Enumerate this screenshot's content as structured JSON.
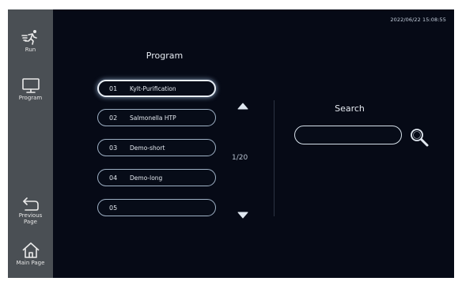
{
  "header": {
    "timestamp": "2022/06/22 15:08:55"
  },
  "sidebar": {
    "items": [
      {
        "label": "Run",
        "icon": "running-person-icon"
      },
      {
        "label": "Program",
        "icon": "monitor-icon"
      },
      {
        "label": "Previous Page",
        "icon": "return-arrow-icon"
      },
      {
        "label": "Main Page",
        "icon": "home-icon"
      }
    ]
  },
  "program": {
    "title": "Program",
    "items": [
      {
        "num": "01",
        "name": "Kylt-Purification"
      },
      {
        "num": "02",
        "name": "Salmonella HTP"
      },
      {
        "num": "03",
        "name": "Demo-short"
      },
      {
        "num": "04",
        "name": "Demo-long"
      },
      {
        "num": "05",
        "name": ""
      }
    ],
    "page_indicator": "1/20"
  },
  "search": {
    "title": "Search",
    "value": "",
    "placeholder": ""
  },
  "colors": {
    "background": "#060a16",
    "sidebar": "#4a4f54",
    "border": "#9fb2c6",
    "text": "#e6ebf2"
  }
}
